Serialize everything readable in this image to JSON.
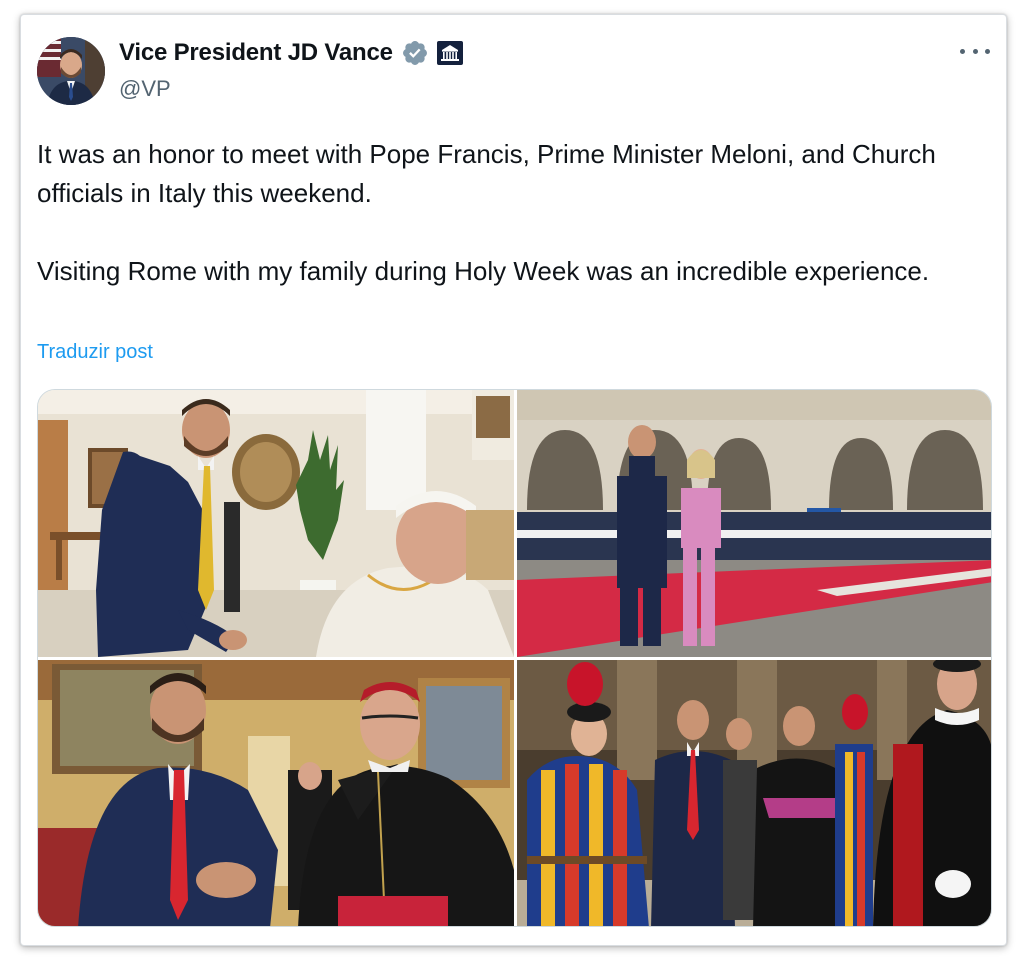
{
  "tweet": {
    "author": {
      "display_name": "Vice President JD Vance",
      "handle": "@VP",
      "verified_badge_icon": "verified-badge-icon",
      "affiliation_icon": "white-house-icon"
    },
    "more_icon": "more-options-icon",
    "body": {
      "paragraph_1": "It was an honor to meet with Pope Francis, Prime Minister Meloni, and Church officials in Italy this weekend.",
      "paragraph_2": "Visiting Rome with my family during Holy Week was an incredible experience."
    },
    "translate_label": "Traduzir post",
    "photos": [
      {
        "subject": "meeting-pope-photo"
      },
      {
        "subject": "welcome-ceremony-photo"
      },
      {
        "subject": "cardinal-handshake-photo"
      },
      {
        "subject": "swiss-guard-procession-photo"
      }
    ]
  },
  "colors": {
    "text_primary": "#0f1419",
    "text_secondary": "#536471",
    "link_blue": "#1d9bf0",
    "verified_gray": "#829aab"
  }
}
